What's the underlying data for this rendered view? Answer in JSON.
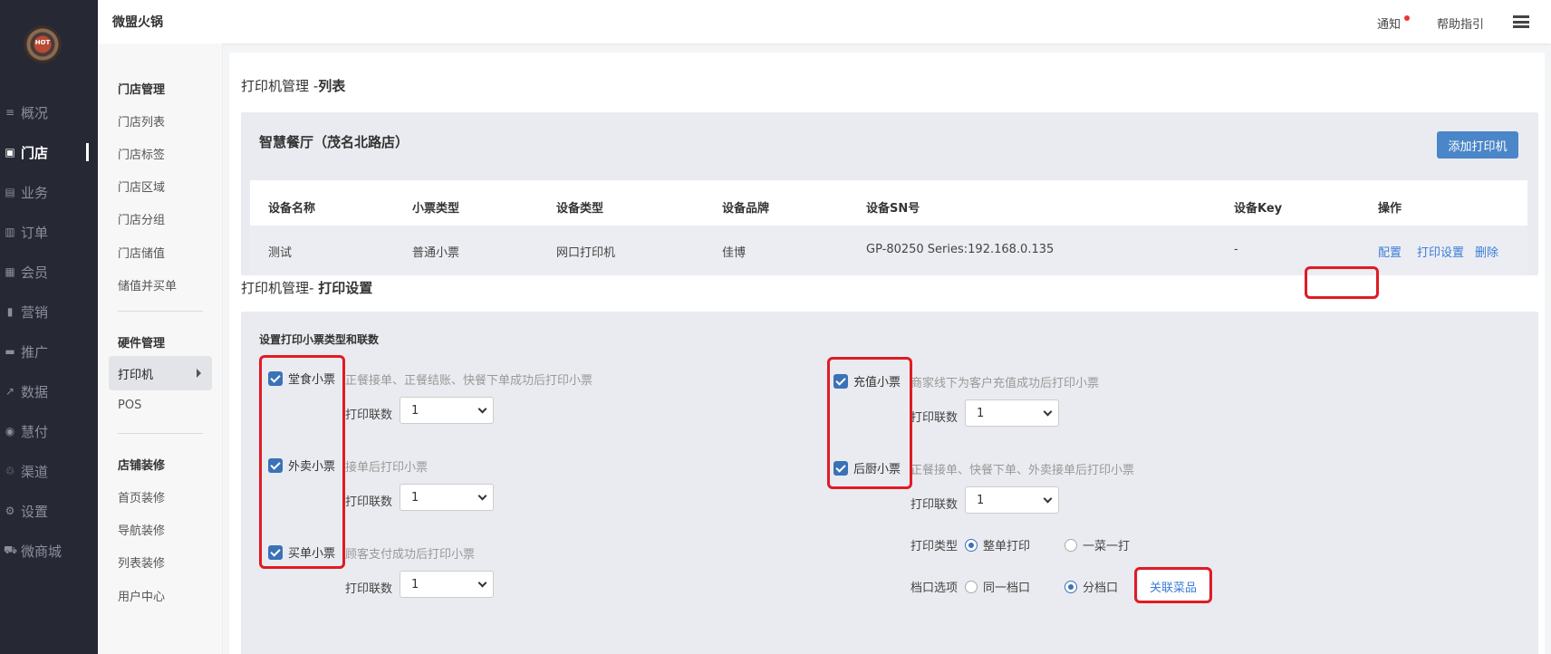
{
  "app": {
    "brand": "微盟火锅",
    "logo_text": "HOT"
  },
  "topbar": {
    "notice": "通知",
    "help": "帮助指引"
  },
  "nav": [
    {
      "icon": "list-icon",
      "glyph": "≡",
      "label": "概况"
    },
    {
      "icon": "store-icon",
      "glyph": "▣",
      "label": "门店"
    },
    {
      "icon": "briefcase-icon",
      "glyph": "▤",
      "label": "业务"
    },
    {
      "icon": "order-icon",
      "glyph": "▥",
      "label": "订单"
    },
    {
      "icon": "member-card-icon",
      "glyph": "▦",
      "label": "会员"
    },
    {
      "icon": "bar-chart-icon",
      "glyph": "▮",
      "label": "营销"
    },
    {
      "icon": "monitor-icon",
      "glyph": "▬",
      "label": "推广"
    },
    {
      "icon": "line-chart-icon",
      "glyph": "↗",
      "label": "数据"
    },
    {
      "icon": "pay-icon",
      "glyph": "◉",
      "label": "慧付"
    },
    {
      "icon": "channel-icon",
      "glyph": "♲",
      "label": "渠道"
    },
    {
      "icon": "settings-icon",
      "glyph": "⚙",
      "label": "设置"
    },
    {
      "icon": "cart-icon",
      "glyph": "⛟",
      "label": "微商城"
    }
  ],
  "subnav": {
    "store_group": "门店管理",
    "store_items": [
      "门店列表",
      "门店标签",
      "门店区域",
      "门店分组",
      "门店储值",
      "储值并买单"
    ],
    "hardware_group": "硬件管理",
    "hardware_items": [
      "打印机",
      "POS"
    ],
    "decor_group": "店铺装修",
    "decor_items": [
      "首页装修",
      "导航装修",
      "列表装修",
      "用户中心"
    ]
  },
  "list_section": {
    "title_prefix": "打印机管理 -",
    "title_bold": "列表",
    "store_name": "智慧餐厅（茂名北路店）",
    "add_button": "添加打印机",
    "columns": [
      "设备名称",
      "小票类型",
      "设备类型",
      "设备品牌",
      "设备SN号",
      "设备Key",
      "操作"
    ],
    "rows": [
      {
        "name": "测试",
        "ticket_type": "普通小票",
        "device_type": "网口打印机",
        "brand": "佳博",
        "sn": "GP-80250 Series:192.168.0.135",
        "key": "-",
        "actions": [
          "配置",
          "打印设置",
          "删除"
        ]
      }
    ]
  },
  "settings_section": {
    "title_prefix": "打印机管理- ",
    "title_bold": "打印设置",
    "panel_title": "设置打印小票类型和联数",
    "copies_label": "打印联数",
    "left_tickets": [
      {
        "label": "堂食小票",
        "checked": true,
        "desc": "正餐接单、正餐结账、快餐下单成功后打印小票",
        "copies": "1"
      },
      {
        "label": "外卖小票",
        "checked": true,
        "desc": "接单后打印小票",
        "copies": "1"
      },
      {
        "label": "买单小票",
        "checked": true,
        "desc": "顾客支付成功后打印小票",
        "copies": "1"
      }
    ],
    "right_tickets": [
      {
        "label": "充值小票",
        "checked": true,
        "desc": "商家线下为客户充值成功后打印小票",
        "copies": "1"
      },
      {
        "label": "后厨小票",
        "checked": true,
        "desc": "正餐接单、快餐下单、外卖接单后打印小票",
        "copies": "1"
      }
    ],
    "print_type": {
      "label": "打印类型",
      "options": [
        "整单打印",
        "一菜一打"
      ],
      "selected": "整单打印"
    },
    "station": {
      "label": "档口选项",
      "options": [
        "同一档口",
        "分档口"
      ],
      "selected": "分档口"
    },
    "link_dishes_button": "关联菜品"
  },
  "colors": {
    "accent": "#4a86c8",
    "sidebar": "#262834",
    "highlight": "#e01b24"
  }
}
